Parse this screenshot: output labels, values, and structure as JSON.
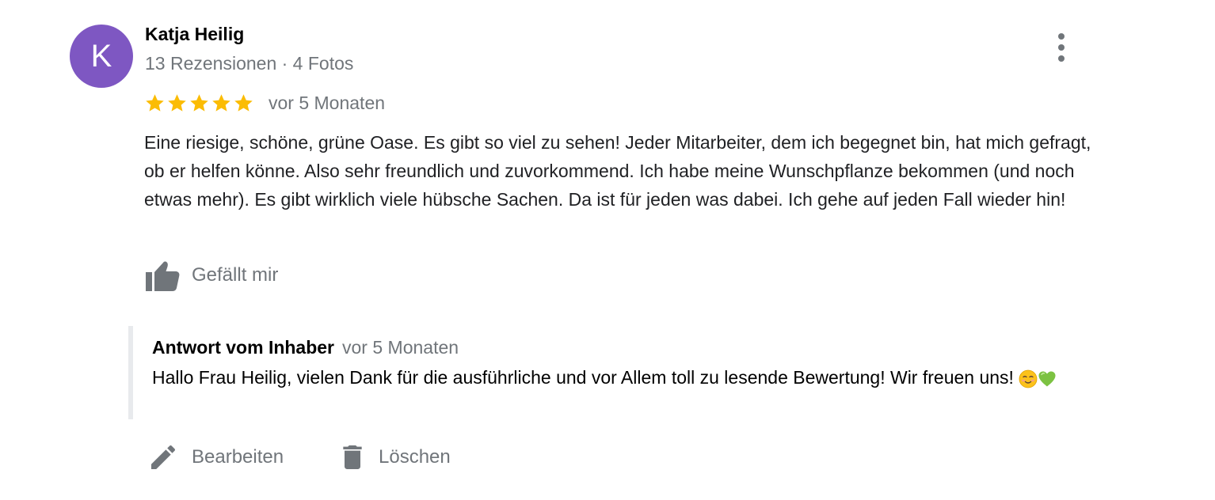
{
  "reviewer": {
    "initial": "K",
    "name": "Katja Heilig",
    "meta": "13 Rezensionen · 4 Fotos",
    "avatar_color": "#7e57c2"
  },
  "review": {
    "stars": 5,
    "max_stars": 5,
    "star_color": "#fbbc04",
    "date": "vor 5 Monaten",
    "text": "Eine riesige, schöne, grüne Oase. Es gibt so viel zu sehen! Jeder Mitarbeiter, dem ich begegnet bin, hat mich gefragt, ob er helfen könne. Also sehr freundlich und zuvorkommend. Ich habe meine Wunschpflanze bekommen (und noch etwas mehr). Es gibt wirklich viele hübsche Sachen. Da ist für jeden was dabei. Ich gehe auf jeden Fall wieder hin!",
    "like_label": "Gefällt mir",
    "like_icon": "thumbs-up-icon",
    "more_icon": "more-vert-icon"
  },
  "owner_reply": {
    "title": "Antwort vom Inhaber",
    "date": "vor 5 Monaten",
    "text": "Hallo Frau Heilig, vielen Dank für die ausführliche und vor Allem toll zu lesende Bewertung! Wir freuen uns!",
    "emojis": [
      "smiling-face-emoji",
      "green-heart-emoji"
    ]
  },
  "actions": {
    "edit_label": "Bearbeiten",
    "edit_icon": "pencil-icon",
    "delete_label": "Löschen",
    "delete_icon": "trash-icon",
    "icon_color": "#70757a"
  }
}
